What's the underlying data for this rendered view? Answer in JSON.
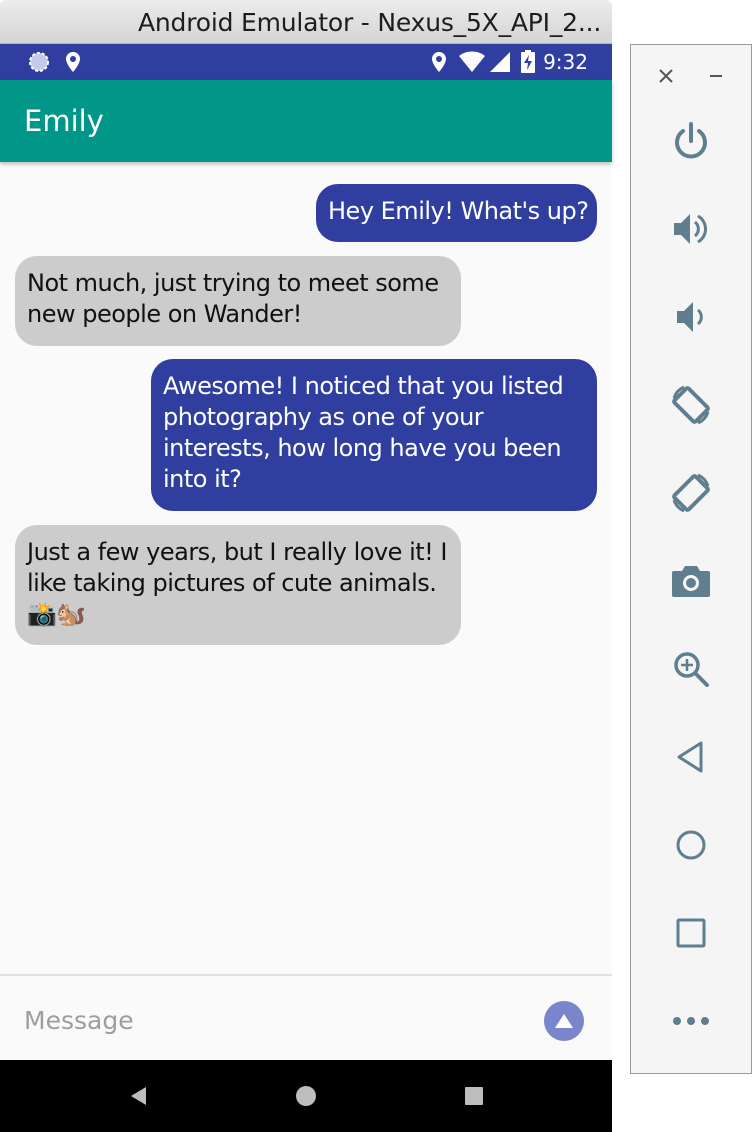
{
  "window": {
    "title": "Android Emulator - Nexus_5X_API_2..."
  },
  "status_bar": {
    "time": "9:32",
    "icons": [
      "sync-icon",
      "location-icon",
      "location-icon",
      "wifi-icon",
      "signal-icon",
      "battery-charging-icon"
    ],
    "color": "#303f9f"
  },
  "app_bar": {
    "title": "Emily",
    "color": "#009688"
  },
  "messages": [
    {
      "direction": "sent",
      "text": "Hey Emily! What's up?"
    },
    {
      "direction": "received",
      "text": "Not much, just trying to meet some new people on Wander!"
    },
    {
      "direction": "sent",
      "text": "Awesome! I noticed that you listed photography as one of your interests, how long have you been into it?"
    },
    {
      "direction": "received",
      "text": "Just a few years, but I really love it! I like taking pictures of cute animals. 📸🐿️"
    }
  ],
  "composer": {
    "placeholder": "Message",
    "value": "",
    "send_icon": "send-arrow-up-icon"
  },
  "nav_bar": {
    "icons": [
      "back-icon",
      "home-icon",
      "recents-icon"
    ]
  },
  "tool_panel": {
    "window_controls": [
      "close-icon",
      "minimize-icon"
    ],
    "tools": [
      "power-icon",
      "volume-up-icon",
      "volume-down-icon",
      "rotate-left-icon",
      "rotate-right-icon",
      "screenshot-camera-icon",
      "zoom-icon",
      "back-icon",
      "home-icon",
      "overview-icon",
      "more-icon"
    ],
    "icon_color": "#5f7f8f"
  },
  "colors": {
    "sent_bubble": "#303f9f",
    "received_bubble": "#cccccc",
    "send_button": "#7986cb"
  }
}
